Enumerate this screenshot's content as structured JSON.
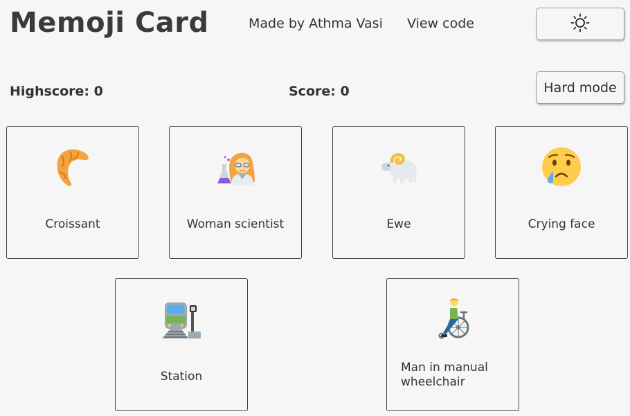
{
  "header": {
    "title": "Memoji Card",
    "author_link": "Made by Athma Vasi",
    "code_link": "View code",
    "theme_toggle_icon": "sun-icon"
  },
  "scores": {
    "highscore": "Highscore: 0",
    "score": "Score: 0"
  },
  "mode_button": "Hard mode",
  "cards": [
    {
      "label": "Croissant",
      "icon": "croissant-icon"
    },
    {
      "label": "Woman scientist",
      "icon": "woman-scientist-icon"
    },
    {
      "label": "Ewe",
      "icon": "ewe-icon"
    },
    {
      "label": "Crying face",
      "icon": "crying-face-icon"
    },
    {
      "label": "Station",
      "icon": "station-icon"
    },
    {
      "label": "Man in manual wheelchair",
      "icon": "man-in-manual-wheelchair-icon"
    }
  ]
}
